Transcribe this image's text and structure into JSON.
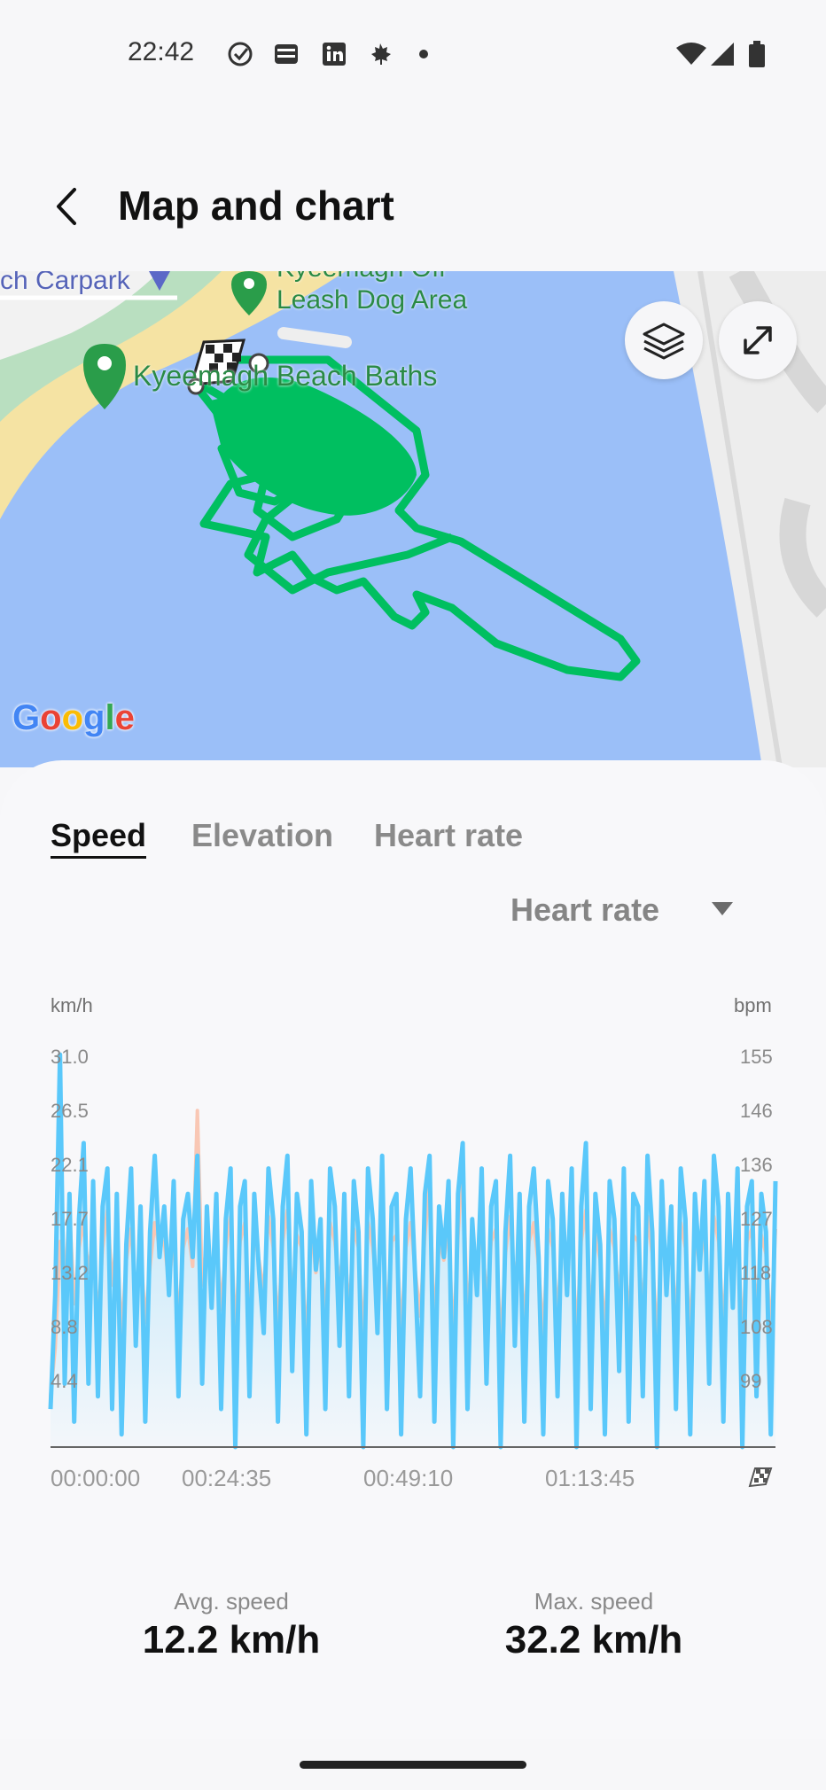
{
  "status_bar": {
    "time": "22:42",
    "left_icons": [
      "check-circle-icon",
      "optus-sport-icon",
      "linkedin-icon",
      "maple-leaf-icon",
      "dot-icon"
    ],
    "right_icons": [
      "wifi-icon",
      "signal-icon",
      "battery-icon"
    ]
  },
  "header": {
    "title": "Map and chart",
    "back_icon": "chevron-left-icon"
  },
  "map": {
    "labels": {
      "carpark": "ch Carpark",
      "dog_area_1": "Kyeemagh Off",
      "dog_area_2": "Leash Dog Area",
      "baths": "Kyeemagh Beach Baths"
    },
    "provider": "Google",
    "route_color": "#00bf60",
    "water_color": "#9bbff8",
    "buttons": [
      "layers-icon",
      "expand-icon"
    ]
  },
  "tabs": [
    {
      "label": "Speed",
      "active": true
    },
    {
      "label": "Elevation",
      "active": false
    },
    {
      "label": "Heart rate",
      "active": false
    }
  ],
  "compare_dropdown": {
    "selected": "Heart rate"
  },
  "chart_data": {
    "type": "line",
    "left_unit": "km/h",
    "right_unit": "bpm",
    "left_ticks": [
      "31.0",
      "26.5",
      "22.1",
      "17.7",
      "13.2",
      "8.8",
      "4.4"
    ],
    "right_ticks": [
      "155",
      "146",
      "136",
      "127",
      "118",
      "108",
      "99"
    ],
    "x_ticks": [
      "00:00:00",
      "00:24:35",
      "00:49:10",
      "01:13:45"
    ],
    "y_range_speed": [
      0,
      31.0
    ],
    "y_range_hr": [
      92,
      155
    ],
    "series": [
      {
        "values": [
          3,
          12,
          31,
          5,
          20,
          2,
          18,
          24,
          5,
          21,
          4,
          19,
          22,
          3,
          20,
          1,
          16,
          22,
          8,
          19,
          2,
          17,
          23,
          15,
          19,
          12,
          21,
          4,
          18,
          20,
          15,
          23,
          5,
          19,
          11,
          20,
          3,
          18,
          22,
          0,
          19,
          21,
          4,
          20,
          14,
          9,
          22,
          18,
          2,
          19,
          23,
          6,
          20,
          17,
          1,
          21,
          14,
          18,
          3,
          22,
          19,
          8,
          20,
          4,
          21,
          17,
          0,
          22,
          18,
          9,
          23,
          3,
          19,
          20,
          1,
          18,
          22,
          13,
          4,
          20,
          23,
          2,
          19,
          15,
          21,
          0,
          20,
          24,
          3,
          18,
          12,
          22,
          5,
          19,
          21,
          0,
          17,
          23,
          8,
          20,
          2,
          19,
          22,
          15,
          1,
          21,
          18,
          4,
          20,
          12,
          22,
          0,
          19,
          24,
          3,
          20,
          16,
          1,
          21,
          18,
          6,
          22,
          2,
          20,
          19,
          4,
          23,
          17,
          0,
          21,
          12,
          19,
          3,
          22,
          18,
          1,
          20,
          14,
          21,
          5,
          23,
          19,
          2,
          20,
          11,
          22,
          0,
          19,
          21,
          4,
          20,
          17,
          1,
          21
        ],
        "color": "#5ac8fa"
      },
      {
        "values": [
          100,
          108,
          125,
          118,
          130,
          115,
          124,
          128,
          120,
          126,
          112,
          124,
          130,
          118,
          126,
          110,
          122,
          127,
          116,
          124,
          112,
          121,
          128,
          124,
          125,
          118,
          126,
          112,
          124,
          127,
          121,
          146,
          118,
          125,
          119,
          127,
          114,
          124,
          129,
          110,
          125,
          128,
          113,
          126,
          122,
          117,
          129,
          124,
          111,
          125,
          130,
          115,
          126,
          124,
          108,
          127,
          120,
          125,
          112,
          128,
          125,
          118,
          126,
          113,
          127,
          124,
          109,
          128,
          124,
          117,
          129,
          112,
          125,
          126,
          110,
          124,
          128,
          120,
          113,
          126,
          134,
          111,
          125,
          122,
          127,
          109,
          126,
          138,
          112,
          124,
          119,
          128,
          115,
          125,
          127,
          108,
          123,
          129,
          118,
          126,
          111,
          125,
          128,
          121,
          110,
          127,
          124,
          113,
          126,
          119,
          128,
          109,
          125,
          130,
          112,
          126,
          122,
          110,
          127,
          124,
          116,
          128,
          111,
          126,
          125,
          113,
          129,
          123,
          109,
          127,
          119,
          125,
          112,
          128,
          124,
          110,
          126,
          121,
          127,
          114,
          129,
          125,
          111,
          126,
          118,
          128,
          109,
          125,
          127,
          113,
          126,
          123,
          110,
          127
        ],
        "color": "#f9c7b4"
      }
    ]
  },
  "stats": [
    {
      "label": "Avg. speed",
      "value": "12.2 km/h"
    },
    {
      "label": "Max. speed",
      "value": "32.2 km/h"
    }
  ]
}
